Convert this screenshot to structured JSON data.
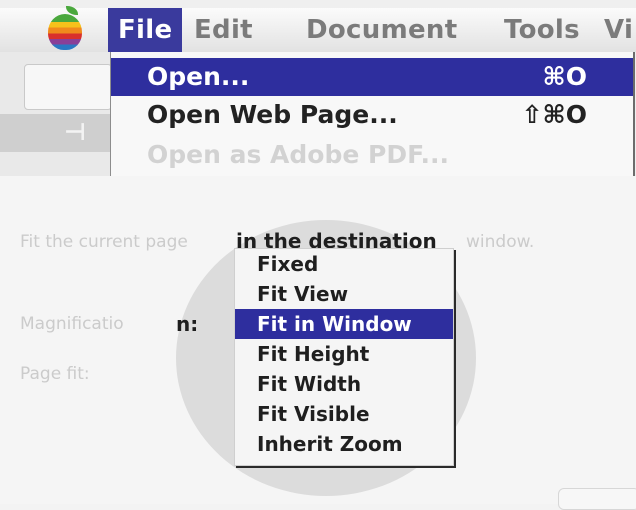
{
  "menubar": {
    "menus": [
      "File",
      "Edit",
      "Document",
      "Tools",
      "Vi"
    ]
  },
  "file_menu": {
    "items": [
      {
        "label": "Open...",
        "shortcut": "⌘O"
      },
      {
        "label": "Open Web Page...",
        "shortcut": "⇧⌘O"
      },
      {
        "label": "Open as Adobe PDF..."
      }
    ]
  },
  "page_content": {
    "hint_faded_left": "Fit the current page",
    "hint_dark": "in the destination",
    "hint_faded_right": "window.",
    "magnification_faded": "Magnificatio",
    "magnification_dark": "n:",
    "page_label": "Page fit:"
  },
  "magnification_popup": {
    "selected": "Fit in Window",
    "options": [
      "Fixed",
      "Fit View",
      "Fit in Window",
      "Fit Height",
      "Fit Width",
      "Fit Visible",
      "Inherit Zoom"
    ]
  },
  "colors": {
    "selection": "#2e2e9e",
    "menubar": "#e2e2e2"
  },
  "icons": [
    "apple-menu-icon"
  ]
}
